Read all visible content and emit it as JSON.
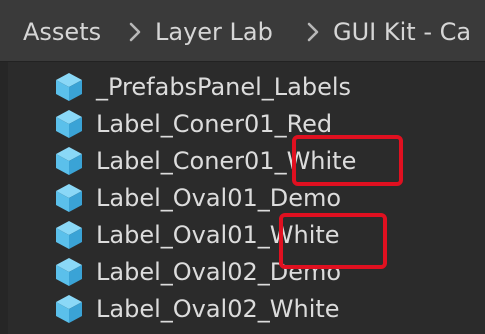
{
  "breadcrumb": {
    "items": [
      "Assets",
      "Layer Lab",
      "GUI Kit - Ca"
    ]
  },
  "project_list": {
    "items": [
      {
        "label": "_PrefabsPanel_Labels"
      },
      {
        "label": "Label_Coner01_Red"
      },
      {
        "label": "Label_Coner01_White"
      },
      {
        "label": "Label_Oval01_Demo"
      },
      {
        "label": "Label_Oval01_White"
      },
      {
        "label": "Label_Oval02_Demo"
      },
      {
        "label": "Label_Oval02_White"
      }
    ]
  },
  "icons": {
    "item_icon": "prefab-cube-icon",
    "separator_icon": "chevron-right-icon"
  },
  "colors": {
    "prefab_icon": "#5bc0eb",
    "highlight": "#e01020",
    "text": "#dcdcdc",
    "header_background": "#3a3a3a",
    "list_background": "#2b2b2b"
  }
}
